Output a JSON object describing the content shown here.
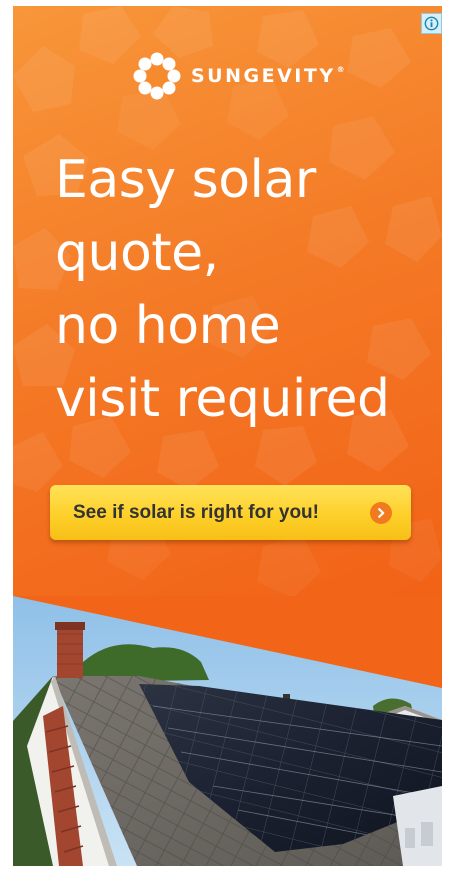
{
  "ad": {
    "brand_name": "SUNGEVITY",
    "trademark": "®",
    "headline_lines": [
      "Easy solar",
      "quote,",
      "no home",
      "visit required"
    ],
    "cta_label": "See if solar is right for you!",
    "info_icon": "info-icon",
    "arrow_icon": "chevron-right-icon",
    "colors": {
      "background_orange": "#f47a26",
      "cta_yellow": "#fdd02a",
      "arrow_orange": "#f27a1e",
      "headline_white": "#ffffff"
    }
  }
}
